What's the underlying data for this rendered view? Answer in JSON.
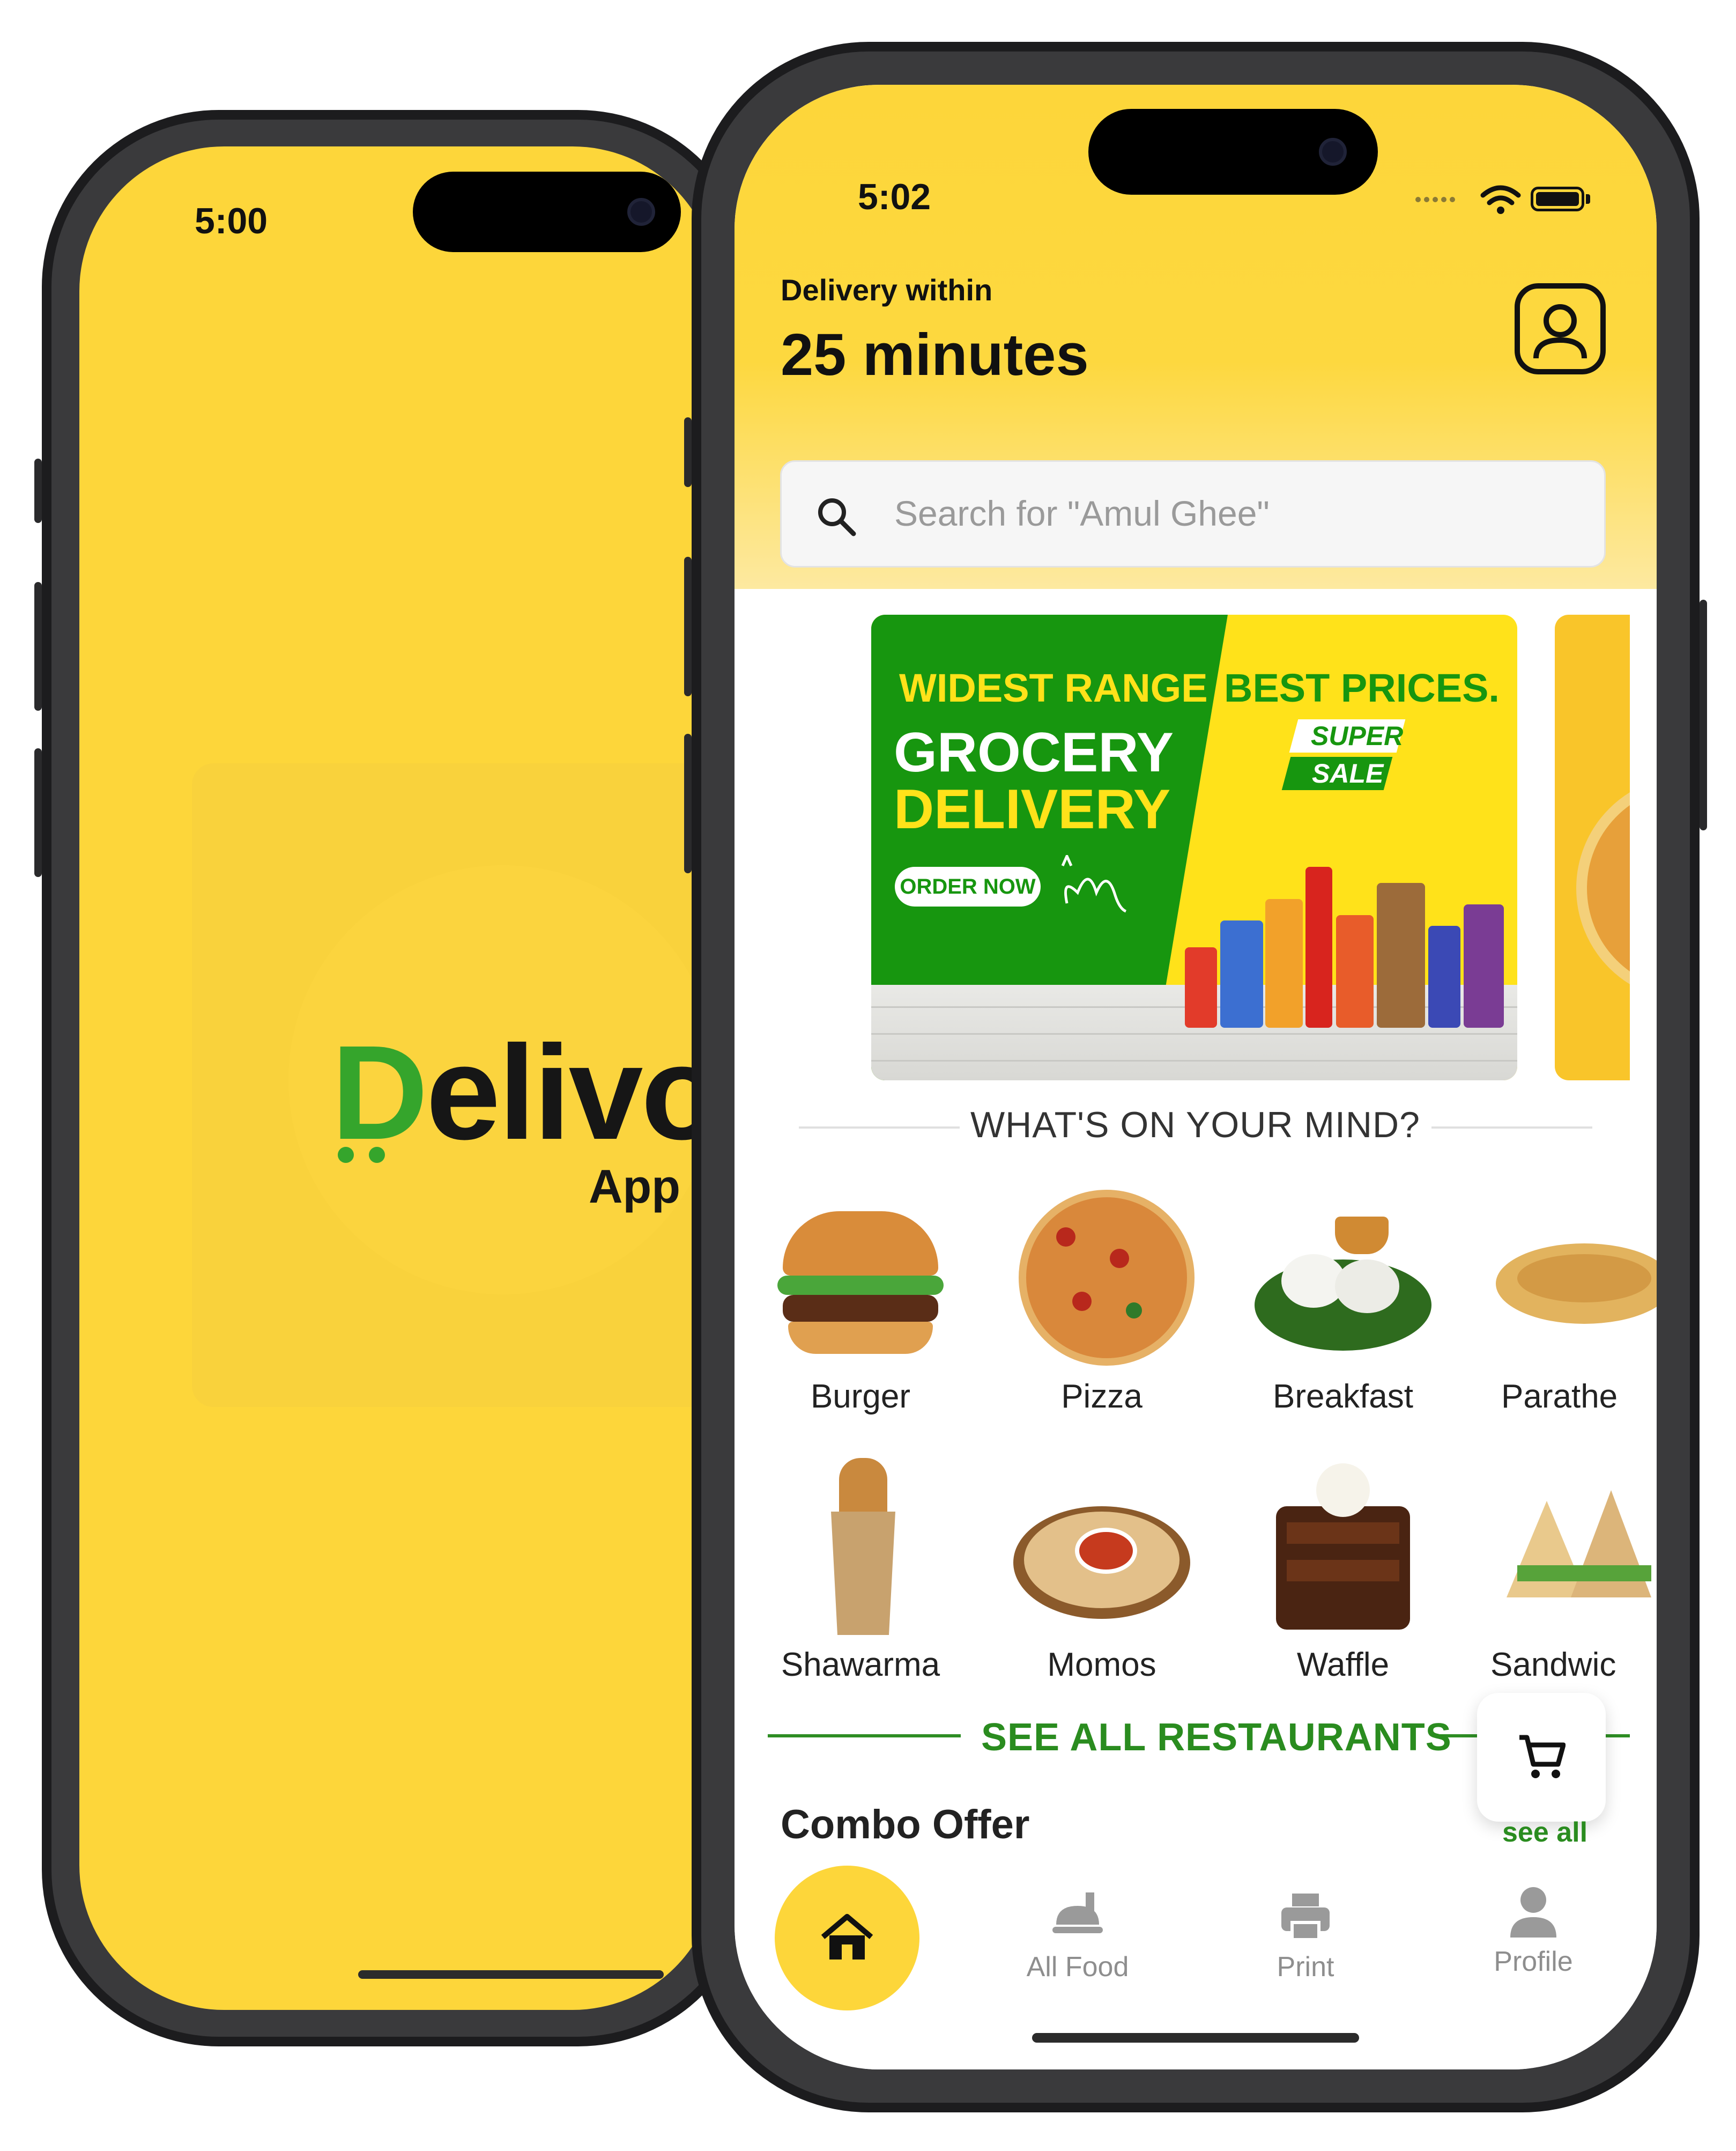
{
  "splash": {
    "status_time": "5:00",
    "logo_first": "D",
    "logo_rest": "elivo",
    "logo_sub": "App",
    "background_color": "#fdd63a",
    "logo_accent_color": "#35a52c"
  },
  "home": {
    "status_time": "5:02",
    "delivery_label": "Delivery within",
    "delivery_time": "25 minutes",
    "search": {
      "placeholder": "Search for \"Amul Ghee\""
    },
    "banner": {
      "line1_left": "WIDEST RANGE",
      "line1_right": "BEST PRICES.",
      "title1": "GROCERY",
      "title2": "DELIVERY",
      "order_button": "ORDER NOW",
      "badge_top": "SUPER",
      "badge_bottom": "SALE"
    },
    "section_title": "WHAT'S ON YOUR MIND?",
    "categories": [
      {
        "label": "Burger"
      },
      {
        "label": "Pizza"
      },
      {
        "label": "Breakfast"
      },
      {
        "label": "Parathe"
      },
      {
        "label": "Shawarma"
      },
      {
        "label": "Momos"
      },
      {
        "label": "Waffle"
      },
      {
        "label": "Sandwic"
      }
    ],
    "see_all_restaurants": "SEE ALL RESTAURANTS",
    "combo_title": "Combo Offer",
    "see_all_link": "see all",
    "tabs": [
      {
        "label": "All Food",
        "icon": "food-tray-icon"
      },
      {
        "label": "Print",
        "icon": "printer-icon"
      },
      {
        "label": "Profile",
        "icon": "person-icon"
      }
    ],
    "accent_color": "#fdd63a",
    "green_color": "#2a8c1f"
  }
}
